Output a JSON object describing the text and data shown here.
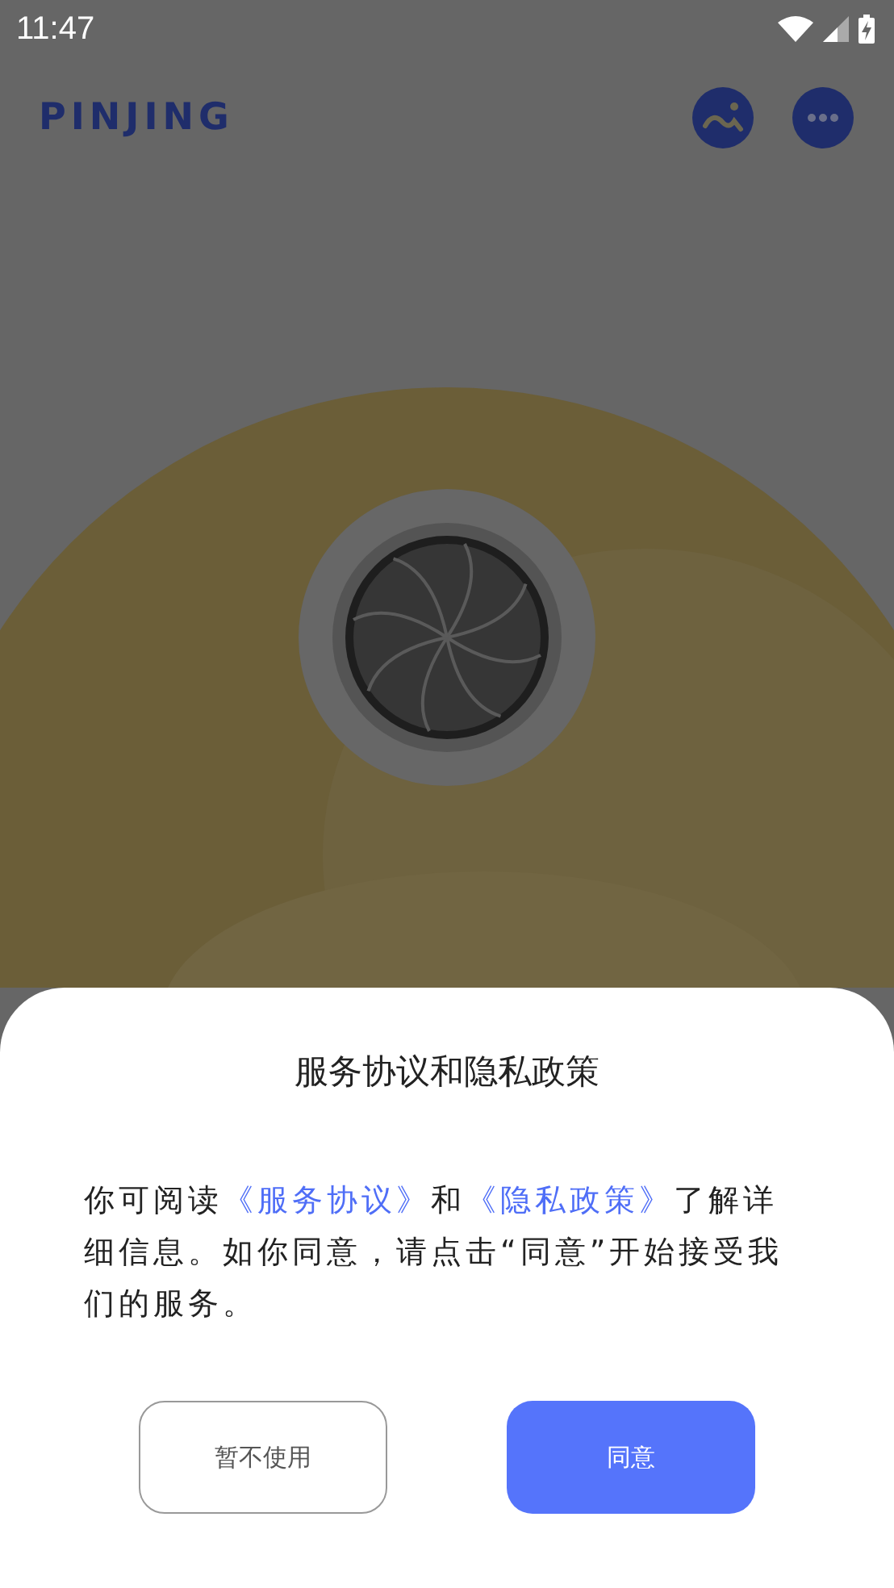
{
  "status_bar": {
    "time": "11:47"
  },
  "header": {
    "logo": "PINJING"
  },
  "dialog": {
    "title": "服务协议和隐私政策",
    "body": [
      {
        "kind": "text",
        "text": "你可阅读"
      },
      {
        "kind": "link",
        "text": "《服务协议》"
      },
      {
        "kind": "text",
        "text": "和"
      },
      {
        "kind": "link",
        "text": "《隐私政策》"
      },
      {
        "kind": "text",
        "text": "了解详细信息。如你同意，请点击“同意”开始接受我们的服务。"
      }
    ],
    "buttons": [
      {
        "kind": "secondary",
        "label": "暂不使用"
      },
      {
        "kind": "primary",
        "label": "同意"
      }
    ]
  }
}
